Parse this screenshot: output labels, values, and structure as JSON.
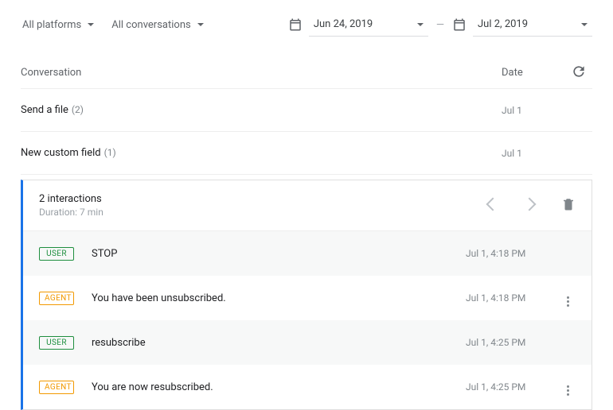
{
  "filters": {
    "platform_label": "All platforms",
    "conversations_label": "All conversations",
    "date_start": "Jun 24, 2019",
    "date_end": "Jul 2, 2019"
  },
  "table_header": {
    "conversation": "Conversation",
    "date": "Date"
  },
  "rows": [
    {
      "title": "Send a file",
      "count": "(2)",
      "date": "Jul 1"
    },
    {
      "title": "New custom field",
      "count": "(1)",
      "date": "Jul 1"
    }
  ],
  "session": {
    "interactions_label": "2 interactions",
    "duration_label": "Duration: 7 min",
    "messages": [
      {
        "role": "USER",
        "text": "STOP",
        "time": "Jul 1, 4:18 PM",
        "alt": true,
        "more": false
      },
      {
        "role": "AGENT",
        "text": "You have been unsubscribed.",
        "time": "Jul 1, 4:18 PM",
        "alt": false,
        "more": true
      },
      {
        "role": "USER",
        "text": "resubscribe",
        "time": "Jul 1, 4:25 PM",
        "alt": true,
        "more": false
      },
      {
        "role": "AGENT",
        "text": "You are now resubscribed.",
        "time": "Jul 1, 4:25 PM",
        "alt": false,
        "more": true
      }
    ]
  }
}
